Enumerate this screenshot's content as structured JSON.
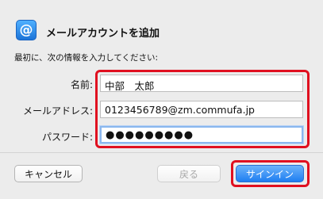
{
  "dialog": {
    "title": "メールアカウントを追加",
    "icon_glyph": "@",
    "icon_name": "mail-at-icon",
    "instruction": "最初に、次の情報を入力してください:"
  },
  "fields": {
    "name_label": "名前:",
    "name_value": "中部　太郎",
    "email_label": "メールアドレス:",
    "email_value": "0123456789@zm.commufa.jp",
    "password_label": "パスワード:",
    "password_masked": "●●●●●●●●●"
  },
  "buttons": {
    "cancel": "キャンセル",
    "back": "戻る",
    "signin": "サインイン"
  },
  "colors": {
    "highlight": "#e01020",
    "primary": "#1f7ef1",
    "background": "#ececec"
  }
}
